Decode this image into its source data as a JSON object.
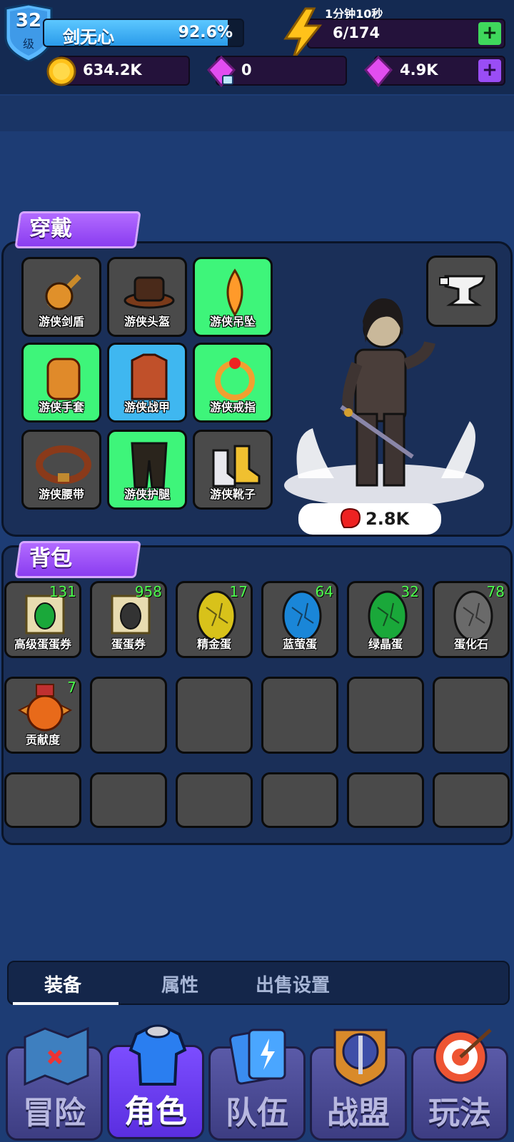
{
  "player": {
    "level": "32",
    "level_unit": "级",
    "name": "剑无心",
    "exp_percent_text": "92.6%",
    "exp_fraction": 0.926
  },
  "energy": {
    "timer": "1分钟10秒",
    "value": "6/174"
  },
  "resources": {
    "gold": "634.2K",
    "locked_gems": "0",
    "gems": "4.9K"
  },
  "equipment": {
    "title": "穿戴",
    "slots": [
      {
        "label": "游侠剑盾",
        "rarity": "gray",
        "icon": "sword-shield-icon"
      },
      {
        "label": "游侠头盔",
        "rarity": "gray",
        "icon": "hat-icon"
      },
      {
        "label": "游侠吊坠",
        "rarity": "green",
        "icon": "pendant-icon"
      },
      {
        "label": "游侠手套",
        "rarity": "green",
        "icon": "gauntlet-icon"
      },
      {
        "label": "游侠战甲",
        "rarity": "blue",
        "icon": "armor-icon"
      },
      {
        "label": "游侠戒指",
        "rarity": "green",
        "icon": "ring-icon"
      },
      {
        "label": "游侠腰带",
        "rarity": "gray",
        "icon": "belt-icon"
      },
      {
        "label": "游侠护腿",
        "rarity": "green",
        "icon": "pants-icon"
      },
      {
        "label": "游侠靴子",
        "rarity": "gray",
        "icon": "boots-icon"
      }
    ],
    "power": "2.8K"
  },
  "bag": {
    "title": "背包",
    "items": [
      {
        "label": "高级蛋蛋券",
        "count": "131",
        "icon": "scroll-green-icon"
      },
      {
        "label": "蛋蛋券",
        "count": "958",
        "icon": "scroll-icon"
      },
      {
        "label": "精金蛋",
        "count": "17",
        "icon": "egg-gold-icon"
      },
      {
        "label": "蓝萤蛋",
        "count": "64",
        "icon": "egg-blue-icon"
      },
      {
        "label": "绿晶蛋",
        "count": "32",
        "icon": "egg-green-icon"
      },
      {
        "label": "蛋化石",
        "count": "78",
        "icon": "egg-fossil-icon"
      },
      {
        "label": "贡献度",
        "count": "7",
        "icon": "contribution-medal-icon"
      }
    ]
  },
  "tabs": [
    "装备",
    "属性",
    "出售设置"
  ],
  "nav": [
    "冒险",
    "角色",
    "队伍",
    "战盟",
    "玩法"
  ],
  "colors": {
    "gray_slot": "#4a4a4a",
    "green_slot": "#3ef57a",
    "blue_slot": "#3fb7f0",
    "count_green": "#4dff4d",
    "section_purple": "#9a4df5"
  }
}
